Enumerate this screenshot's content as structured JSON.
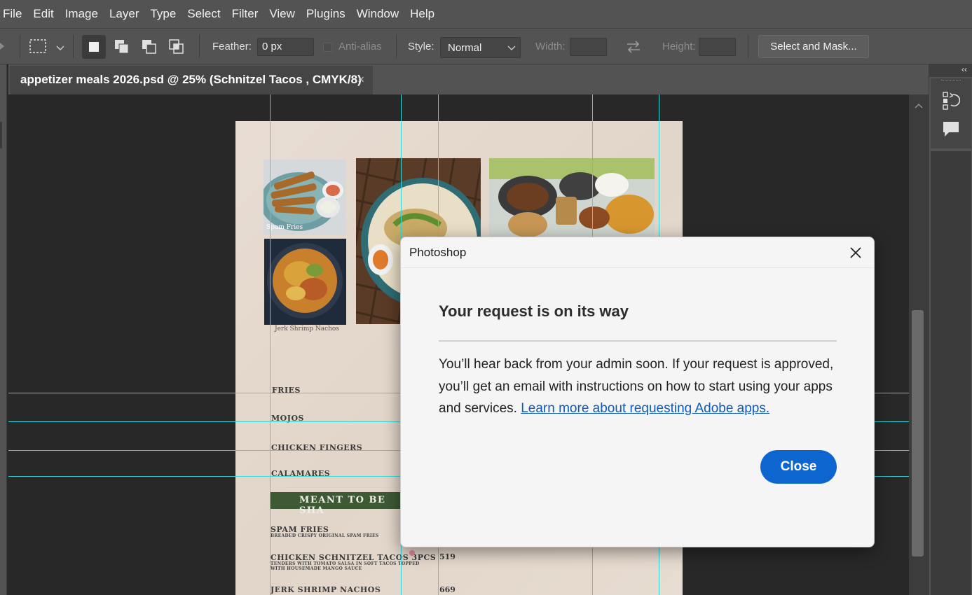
{
  "menubar": {
    "items": [
      "File",
      "Edit",
      "Image",
      "Layer",
      "Type",
      "Select",
      "Filter",
      "View",
      "Plugins",
      "Window",
      "Help"
    ]
  },
  "options": {
    "feather_label": "Feather:",
    "feather_value": "0 px",
    "antialias_label": "Anti-alias",
    "style_label": "Style:",
    "style_value": "Normal",
    "width_label": "Width:",
    "height_label": "Height:",
    "select_mask_label": "Select and Mask..."
  },
  "tab": {
    "title": "appetizer meals 2026.psd @ 25% (Schnitzel Tacos , CMYK/8)",
    "close": "×"
  },
  "document": {
    "captions": [
      "Spam Fries",
      "Jerk Shrimp Nachos"
    ],
    "menu_items": [
      "FRIES",
      "MOJOS",
      "CHICKEN FINGERS",
      "CALAMARES"
    ],
    "section_title": "MEANT TO BE SHA",
    "dishes": [
      {
        "name": "SPAM FRIES",
        "desc": "BREADED CRISPY ORIGINAL SPAM FRIES",
        "price": ""
      },
      {
        "name": "CHICKEN SCHNITZEL TACOS 3PCS",
        "desc": "TENDERS WITH TOMATO SALSA IN SOFT TACOS TOPPED WITH HOUSEMADE MANGO SAUCE",
        "price": "519"
      },
      {
        "name": "JERK SHRIMP NACHOS",
        "desc": "",
        "price": "669"
      }
    ]
  },
  "dialog": {
    "title": "Photoshop",
    "heading": "Your request is on its way",
    "body": "You’ll hear back from your admin soon. If your request is approved, you’ll get an email with instructions on how to start using your apps and services. ",
    "link": "Learn more about requesting Adobe apps.",
    "close_button": "Close"
  },
  "colors": {
    "accent": "#0d66d0",
    "link": "#0e5bbd",
    "guide": "#34d6d6",
    "menu_band": "#3d5a35"
  }
}
